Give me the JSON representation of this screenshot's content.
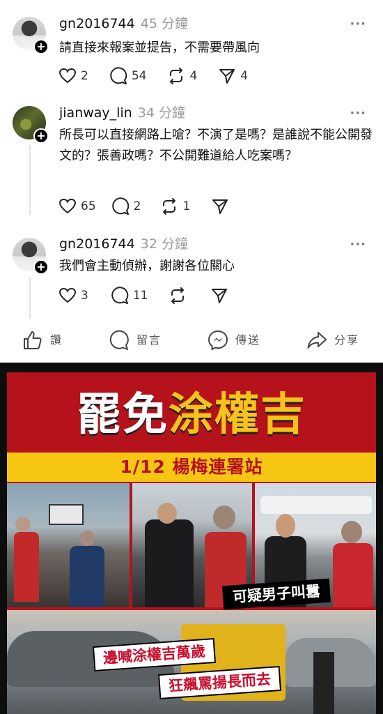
{
  "posts": [
    {
      "username": "gn2016744",
      "time": "45 分鐘",
      "text": "請直接來報案並提告，不需要帶風向",
      "likes": "2",
      "comments": "54",
      "reposts": "4",
      "shares": "4"
    },
    {
      "username": "jianway_lin",
      "time": "34 分鐘",
      "text": "所長可以直接網路上嗆？不演了是嗎？是誰說不能公開發文的？張善政嗎？不公開難道給人吃案嗎？",
      "likes": "65",
      "comments": "2",
      "reposts": "1",
      "shares": ""
    },
    {
      "username": "gn2016744",
      "time": "32 分鐘",
      "text": "我們會主動偵辦，謝謝各位關心",
      "likes": "3",
      "comments": "11",
      "reposts": "",
      "shares": ""
    }
  ],
  "fb_actions": {
    "like": "讚",
    "comment": "留言",
    "send": "傳送",
    "share": "分享"
  },
  "poster": {
    "title_white": "罷免",
    "title_yellow": "涂權吉",
    "date_station": "1/12 楊梅連署站",
    "caption_1": "可疑男子叫囂",
    "caption_2": "邊喊涂權吉萬歲",
    "caption_3": "狂飆罵揚長而去",
    "colors": {
      "red": "#b5121b",
      "yellow": "#f6c613"
    }
  },
  "icons": [
    "heart-icon",
    "comment-icon",
    "repost-icon",
    "send-icon",
    "thumbs-up-icon",
    "messenger-icon",
    "share-arrow-icon",
    "more-icon",
    "follow-plus-icon"
  ]
}
